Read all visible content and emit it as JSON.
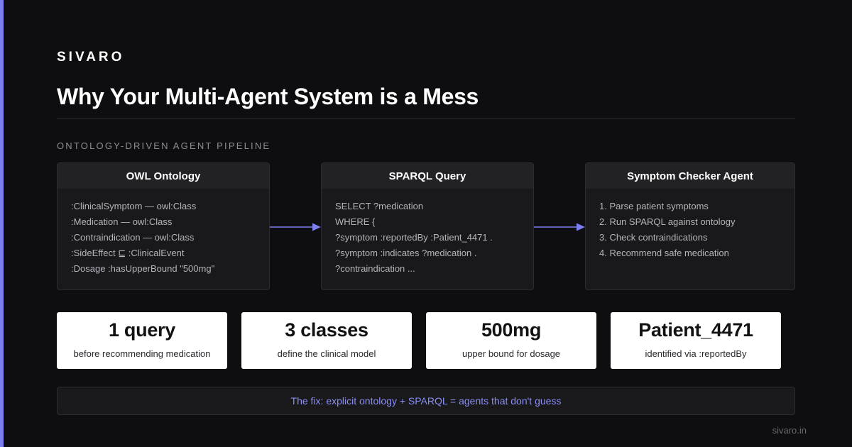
{
  "brand": "SIVARO",
  "title": "Why Your Multi-Agent System is a Mess",
  "section_label": "ONTOLOGY-DRIVEN AGENT PIPELINE",
  "panels": [
    {
      "title": "OWL Ontology",
      "lines": [
        ":ClinicalSymptom — owl:Class",
        ":Medication — owl:Class",
        ":Contraindication — owl:Class",
        ":SideEffect ⊑ :ClinicalEvent",
        ":Dosage :hasUpperBound \"500mg\""
      ]
    },
    {
      "title": "SPARQL Query",
      "lines": [
        "SELECT ?medication",
        "WHERE {",
        "?symptom :reportedBy :Patient_4471 .",
        "?symptom :indicates ?medication .",
        "?contraindication ..."
      ]
    },
    {
      "title": "Symptom Checker Agent",
      "lines": [
        "1. Parse patient symptoms",
        "2. Run SPARQL against ontology",
        "3. Check contraindications",
        "4. Recommend safe medication"
      ]
    }
  ],
  "stats": [
    {
      "value": "1 query",
      "caption": "before recommending medication"
    },
    {
      "value": "3 classes",
      "caption": "define the clinical model"
    },
    {
      "value": "500mg",
      "caption": "upper bound for dosage"
    },
    {
      "value": "Patient_4471",
      "caption": "identified via :reportedBy"
    }
  ],
  "fix_text": "The fix: explicit ontology + SPARQL = agents that don't guess",
  "footer_url": "sivaro.in",
  "colors": {
    "background": "#0e0e10",
    "accent": "#7b7ff0",
    "panel": "#19191c",
    "panel_header": "#222225",
    "fix_text": "#8a8ef5"
  },
  "icons": {
    "pipeline_connector": "arrow-right-icon"
  }
}
